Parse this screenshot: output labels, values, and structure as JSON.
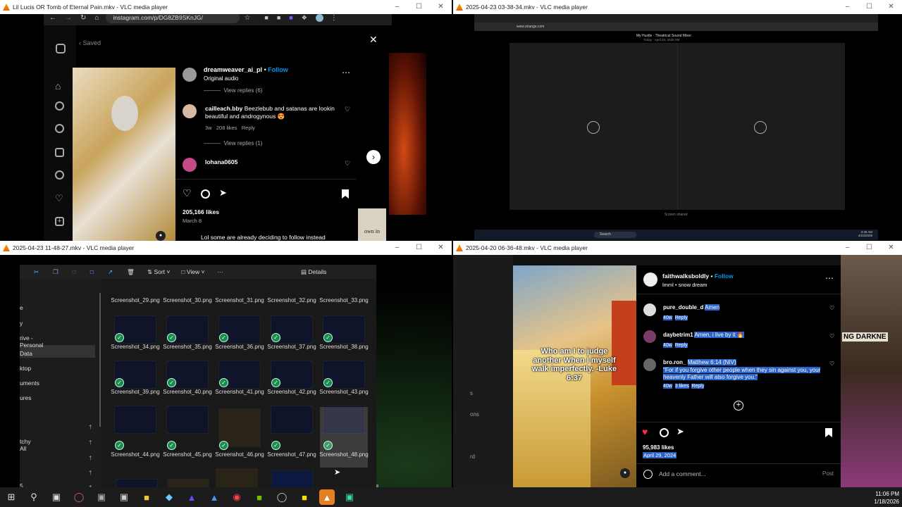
{
  "windows": {
    "tl": {
      "title": "Lil Lucis OR Tomb of Eternal Pain.mkv - VLC media player"
    },
    "tr": {
      "title": "2025-04-23 03-38-34.mkv - VLC media player"
    },
    "bl": {
      "title": "2025-04-23 11-48-27.mkv - VLC media player"
    },
    "br": {
      "title": "2025-04-20 06-36-48.mkv - VLC media player"
    }
  },
  "window_controls": {
    "minimize": "–",
    "maximize": "☐",
    "close": "✕"
  },
  "tl": {
    "url": "instagram.com/p/DG8ZB9SKnJG/",
    "saved": "Saved",
    "user": "dreamweaver_ai_pl",
    "dot": "•",
    "follow": "Follow",
    "audio": "Original audio",
    "view_replies_1": "View replies (6)",
    "comment_user": "cailleach.bby",
    "comment_text": "Beezlebub and satanas are lookin beautiful and androgynous 😍",
    "comment_meta_time": "3w",
    "comment_meta_likes": "208 likes",
    "comment_meta_reply": "Reply",
    "view_replies_2": "View replies (1)",
    "comment2_user": "lohana0605",
    "likes": "205,166 likes",
    "date": "March 8",
    "bottom_text": "Lol some are already deciding to follow instead",
    "side_text": "own in"
  },
  "tr": {
    "url": "www.strange.com",
    "video_title": "My Hustle · Theatrical Sound Mixer",
    "video_sub": "Today · April 23, 2025 AM",
    "status": "Screen shared",
    "search": "Search",
    "time": "3:38 AM",
    "date": "4/23/2025"
  },
  "bl": {
    "toolbar": {
      "sort": "Sort",
      "view": "View",
      "more": "···",
      "details": "Details"
    },
    "nav": [
      "e",
      "y",
      "rive - Personal",
      "Data",
      "ktop",
      "uments",
      "ures",
      "tchy All",
      "5 DTD"
    ],
    "files": [
      [
        "Screenshot_29.png",
        "Screenshot_30.png",
        "Screenshot_31.png",
        "Screenshot_32.png",
        "Screenshot_33.png"
      ],
      [
        "Screenshot_34.png",
        "Screenshot_35.png",
        "Screenshot_36.png",
        "Screenshot_37.png",
        "Screenshot_38.png"
      ],
      [
        "Screenshot_39.png",
        "Screenshot_40.png",
        "Screenshot_41.png",
        "Screenshot_42.png",
        "Screenshot_43.png"
      ],
      [
        "Screenshot_44.png",
        "Screenshot_45.png",
        "Screenshot_46.png",
        "Screenshot_47.png",
        "Screenshot_48.png"
      ]
    ]
  },
  "br": {
    "user": "faithwalksboldly",
    "dot": "•",
    "follow": "Follow",
    "audio": "lmml • snow dream",
    "c1_user": "pure_double_d",
    "c1_text": "Amen",
    "c1_time": "40w",
    "c1_reply": "Reply",
    "c2_user": "daybetrim1",
    "c2_text": "Amen, i live by it 🔥",
    "c2_time": "40w",
    "c2_reply": "Reply",
    "c3_user": "bro.ron_",
    "c3_text1": "Matthew 6:14 (NIV)",
    "c3_text2": "\"For if you forgive other people when they sin against you, your heavenly Father will also forgive you.\"",
    "c3_time": "40w",
    "c3_likes": "3 likes",
    "c3_reply": "Reply",
    "likes": "95,983 likes",
    "date": "April 29, 2024",
    "comment_placeholder": "Add a comment...",
    "post": "Post",
    "overlay": "Who am I to judge another When I myself walk imperfectly. -Luke 6:37",
    "right_text": "NG DARKNE",
    "left_texts": [
      "s",
      "ons",
      "rd"
    ]
  },
  "taskbar": {
    "time": "11:06 PM",
    "date": "1/18/2026"
  },
  "colors": {
    "accent": "#0095f6",
    "like": "#ff3040",
    "check": "#1e8a4b",
    "vlc": "#ff8800"
  }
}
